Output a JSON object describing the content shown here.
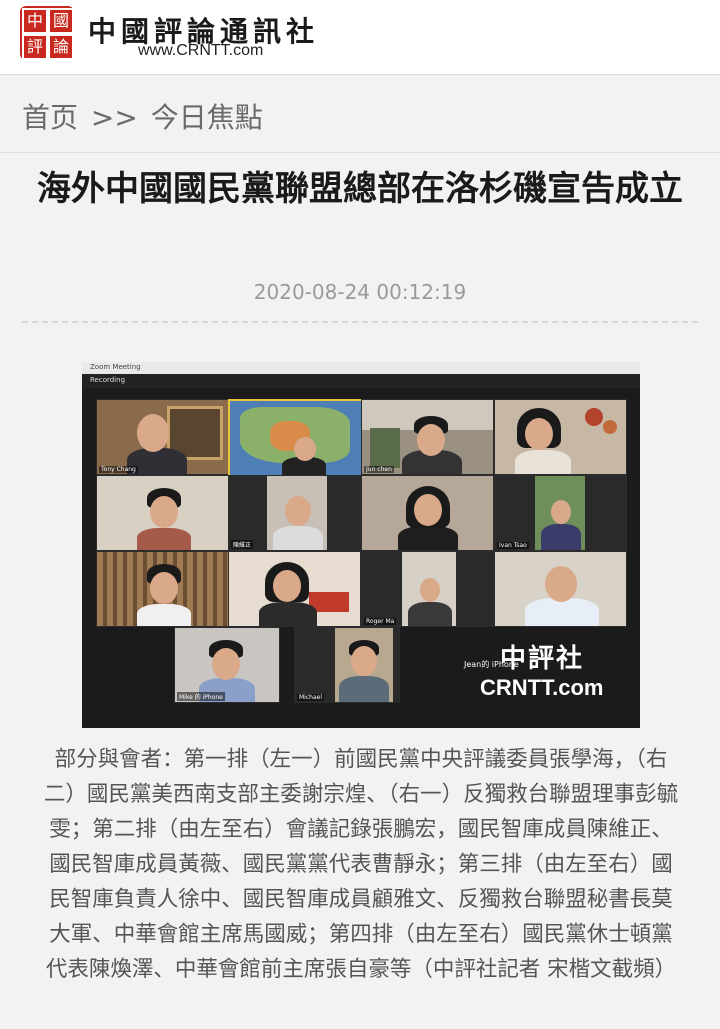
{
  "site": {
    "logo_chars": [
      "中",
      "國",
      "評",
      "論"
    ],
    "name": "中國評論通訊社",
    "url": "www.CRNTT.com"
  },
  "breadcrumb": {
    "home": "首页",
    "separator": ">>",
    "section": "今日焦點"
  },
  "article": {
    "title": "海外中國國民黨聯盟總部在洛杉磯宣告成立",
    "date": "2020-08-24 00:12:19",
    "caption": "部分與會者：第一排（左一）前國民黨中央評議委員張學海，（右二）國民黨美西南支部主委謝宗煌、（右一）反獨救台聯盟理事彭毓雯；第二排（由左至右）會議記錄張鵬宏，國民智庫成員陳維正、國民智庫成員黃薇、國民黨黨代表曹靜永；第三排（由左至右）國民智庫負責人徐中、國民智庫成員顧雅文、反獨救台聯盟秘書長莫大軍、中華會館主席馬國威；第四排（由左至右）國民黨休士頓黨代表陳煥澤、中華會館前主席張自豪等（中評社記者 宋楷文截頻）"
  },
  "photo": {
    "window_title": "Zoom Meeting",
    "recording_label": "Recording",
    "watermark_cn": "中評社",
    "watermark_en": "CRNTT.com",
    "watermark_credit": "Jean的 iPhone",
    "participants": [
      "Tony Chang",
      "",
      "Jun chen",
      "",
      "",
      "陳維正",
      "",
      "Ivan Tsao",
      "",
      "",
      "Roger Ma",
      "",
      "Mike 的 iPhone",
      "Michael"
    ]
  },
  "colors": {
    "brand_red": "#c8281e",
    "background": "#f2f2f2",
    "caption_text": "#555555"
  }
}
